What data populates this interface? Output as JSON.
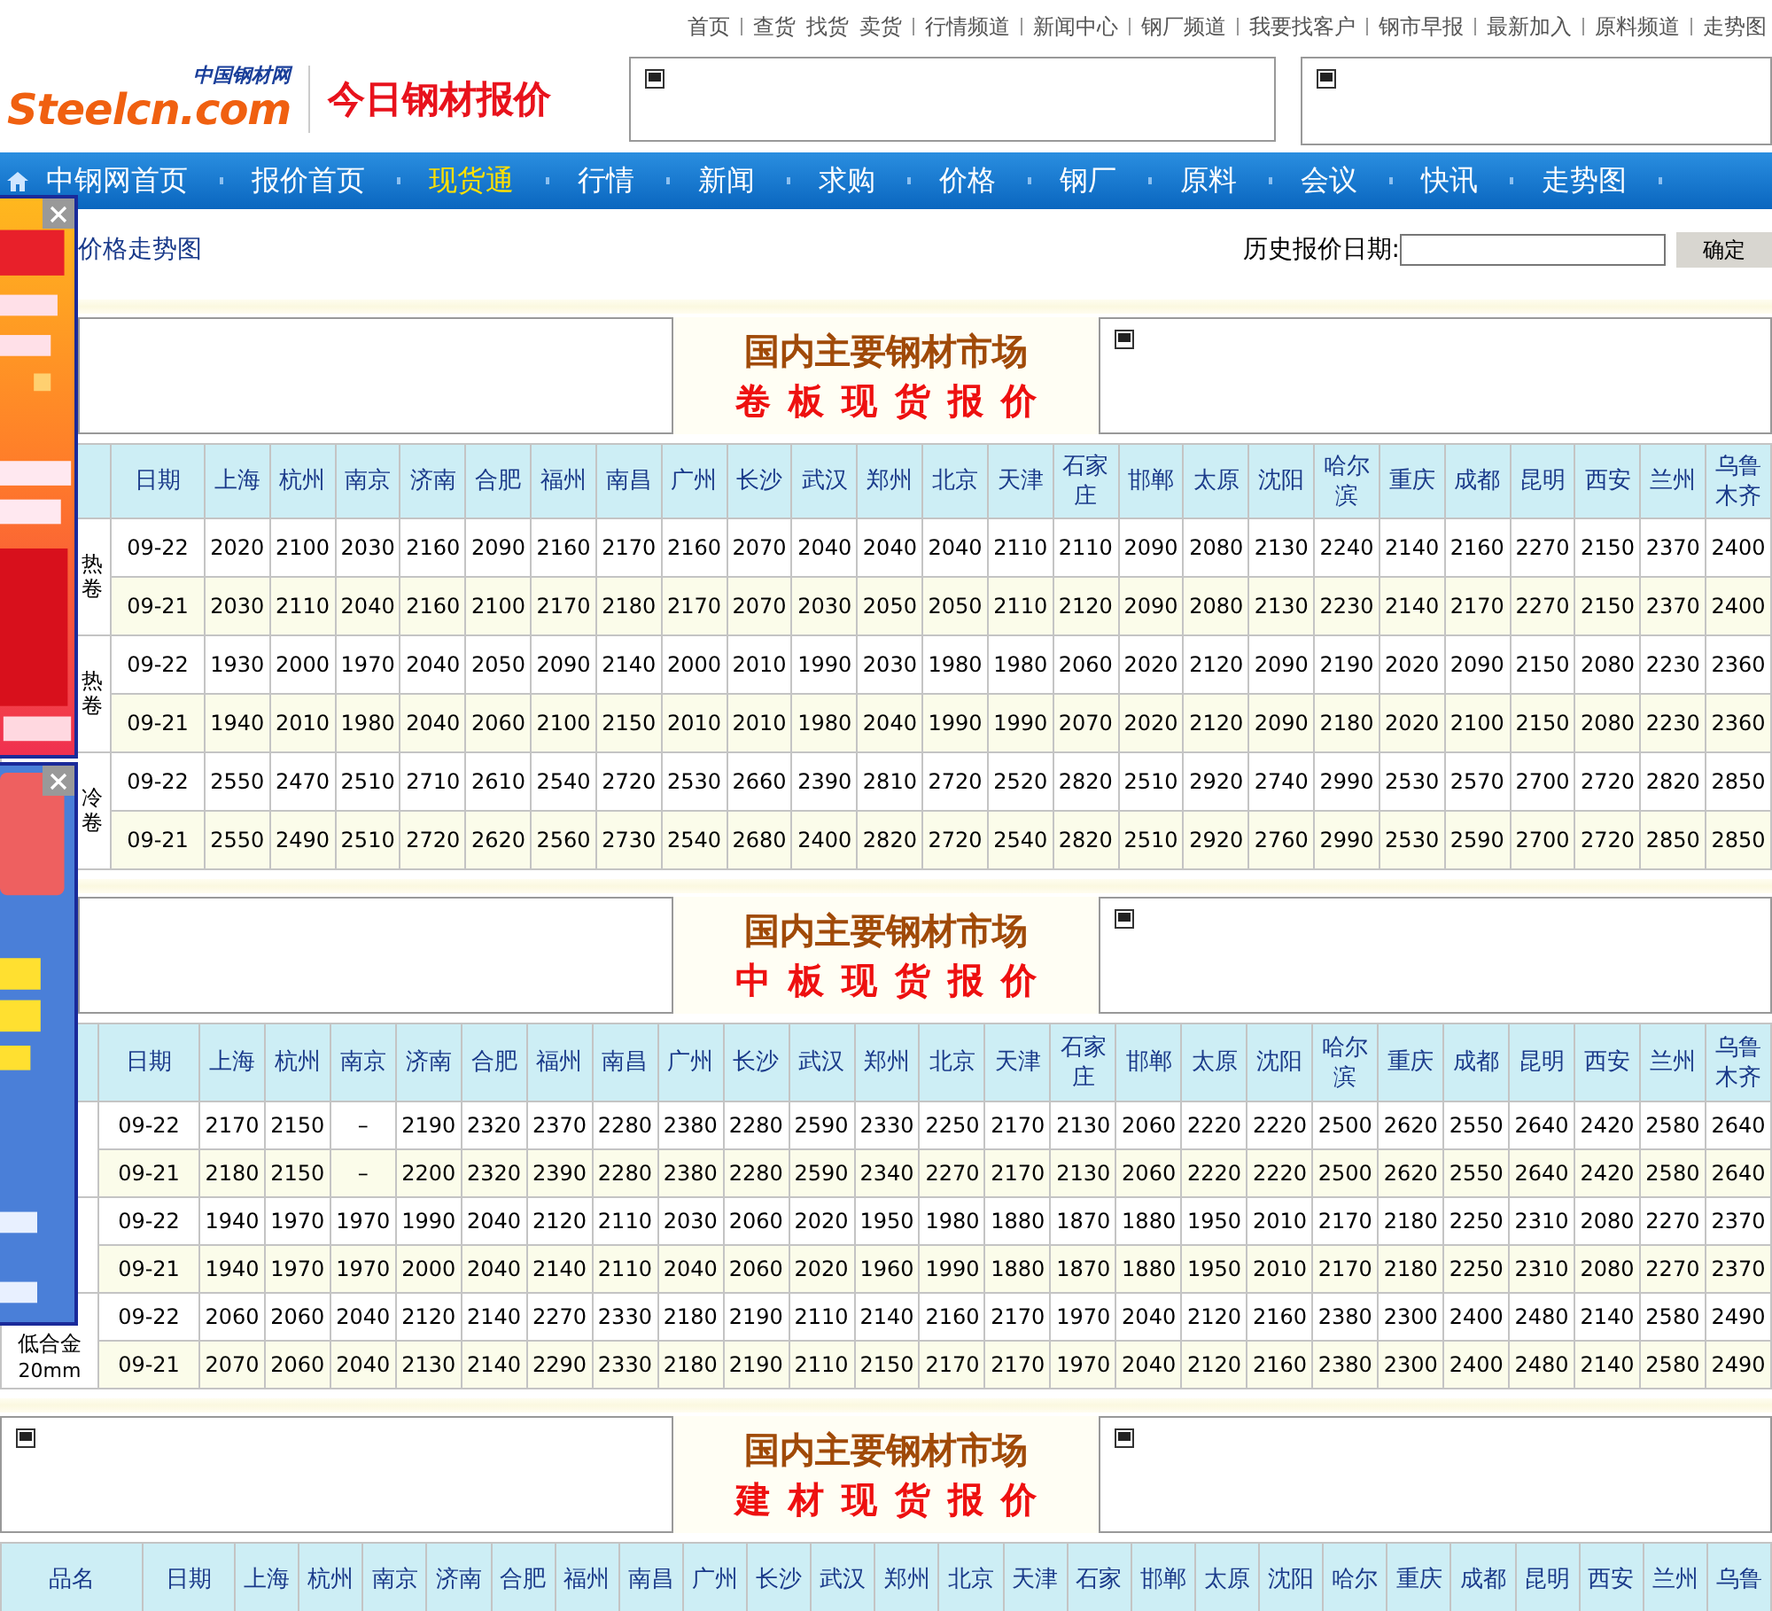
{
  "top_links": [
    [
      "首页"
    ],
    [
      "查货",
      "找货",
      "卖货"
    ],
    [
      "行情频道"
    ],
    [
      "新闻中心"
    ],
    [
      "钢厂频道"
    ],
    [
      "我要找客户"
    ],
    [
      "钢市早报"
    ],
    [
      "最新加入"
    ],
    [
      "原料频道"
    ],
    [
      "走势图"
    ]
  ],
  "logo": {
    "small": "中国钢材网",
    "main": "Steelcn.com",
    "title": "今日钢材报价"
  },
  "nav": [
    {
      "label": "中钢网首页",
      "selected": false
    },
    {
      "label": "报价首页",
      "selected": false
    },
    {
      "label": "现货通",
      "selected": true
    },
    {
      "label": "行情",
      "selected": false
    },
    {
      "label": "新闻",
      "selected": false
    },
    {
      "label": "求购",
      "selected": false
    },
    {
      "label": "价格",
      "selected": false
    },
    {
      "label": "钢厂",
      "selected": false
    },
    {
      "label": "原料",
      "selected": false
    },
    {
      "label": "会议",
      "selected": false
    },
    {
      "label": "快讯",
      "selected": false
    },
    {
      "label": "走势图",
      "selected": false
    }
  ],
  "breadcrumb_link": "价格走势图",
  "history": {
    "label": "历史报价日期:",
    "button": "确定"
  },
  "sections": [
    {
      "title": "国内主要钢材市场",
      "subtitle": "卷板现货报价",
      "table": {
        "columns": [
          "日期",
          "上海",
          "杭州",
          "南京",
          "济南",
          "合肥",
          "福州",
          "南昌",
          "广州",
          "长沙",
          "武汉",
          "郑州",
          "北京",
          "天津",
          "石家庄",
          "邯郸",
          "太原",
          "沈阳",
          "哈尔滨",
          "重庆",
          "成都",
          "昆明",
          "西安",
          "兰州",
          "乌鲁木齐"
        ],
        "groups": [
          {
            "product": "热卷",
            "rows": [
              {
                "date": "09-22",
                "prices": [
                  "2020",
                  "2100",
                  "2030",
                  "2160",
                  "2090",
                  "2160",
                  "2170",
                  "2160",
                  "2070",
                  "2040",
                  "2040",
                  "2040",
                  "2110",
                  "2110",
                  "2090",
                  "2080",
                  "2130",
                  "2240",
                  "2140",
                  "2160",
                  "2270",
                  "2150",
                  "2370",
                  "2400"
                ]
              },
              {
                "date": "09-21",
                "prices": [
                  "2030",
                  "2110",
                  "2040",
                  "2160",
                  "2100",
                  "2170",
                  "2180",
                  "2170",
                  "2070",
                  "2030",
                  "2050",
                  "2050",
                  "2110",
                  "2120",
                  "2090",
                  "2080",
                  "2130",
                  "2230",
                  "2140",
                  "2170",
                  "2270",
                  "2150",
                  "2370",
                  "2400"
                ]
              }
            ]
          },
          {
            "product": "热卷",
            "rows": [
              {
                "date": "09-22",
                "prices": [
                  "1930",
                  "2000",
                  "1970",
                  "2040",
                  "2050",
                  "2090",
                  "2140",
                  "2000",
                  "2010",
                  "1990",
                  "2030",
                  "1980",
                  "1980",
                  "2060",
                  "2020",
                  "2120",
                  "2090",
                  "2190",
                  "2020",
                  "2090",
                  "2150",
                  "2080",
                  "2230",
                  "2360"
                ]
              },
              {
                "date": "09-21",
                "prices": [
                  "1940",
                  "2010",
                  "1980",
                  "2040",
                  "2060",
                  "2100",
                  "2150",
                  "2010",
                  "2010",
                  "1980",
                  "2040",
                  "1990",
                  "1990",
                  "2070",
                  "2020",
                  "2120",
                  "2090",
                  "2180",
                  "2020",
                  "2100",
                  "2150",
                  "2080",
                  "2230",
                  "2360"
                ]
              }
            ]
          },
          {
            "product": "冷卷",
            "rows": [
              {
                "date": "09-22",
                "prices": [
                  "2550",
                  "2470",
                  "2510",
                  "2710",
                  "2610",
                  "2540",
                  "2720",
                  "2530",
                  "2660",
                  "2390",
                  "2810",
                  "2720",
                  "2520",
                  "2820",
                  "2510",
                  "2920",
                  "2740",
                  "2990",
                  "2530",
                  "2570",
                  "2700",
                  "2720",
                  "2820",
                  "2850"
                ]
              },
              {
                "date": "09-21",
                "prices": [
                  "2550",
                  "2490",
                  "2510",
                  "2720",
                  "2620",
                  "2560",
                  "2730",
                  "2540",
                  "2680",
                  "2400",
                  "2820",
                  "2720",
                  "2540",
                  "2820",
                  "2510",
                  "2920",
                  "2760",
                  "2990",
                  "2530",
                  "2590",
                  "2700",
                  "2720",
                  "2850",
                  "2850"
                ]
              }
            ]
          }
        ]
      }
    },
    {
      "title": "国内主要钢材市场",
      "subtitle": "中板现货报价",
      "table": {
        "columns": [
          "日期",
          "上海",
          "杭州",
          "南京",
          "济南",
          "合肥",
          "福州",
          "南昌",
          "广州",
          "长沙",
          "武汉",
          "郑州",
          "北京",
          "天津",
          "石家庄",
          "邯郸",
          "太原",
          "沈阳",
          "哈尔滨",
          "重庆",
          "成都",
          "昆明",
          "西安",
          "兰州",
          "乌鲁木齐"
        ],
        "groups": [
          {
            "rows": [
              {
                "date": "09-22",
                "prices": [
                  "2170",
                  "2150",
                  "–",
                  "2190",
                  "2320",
                  "2370",
                  "2280",
                  "2380",
                  "2280",
                  "2590",
                  "2330",
                  "2250",
                  "2170",
                  "2130",
                  "2060",
                  "2220",
                  "2220",
                  "2500",
                  "2620",
                  "2550",
                  "2640",
                  "2420",
                  "2580",
                  "2640"
                ]
              },
              {
                "date": "09-21",
                "prices": [
                  "2180",
                  "2150",
                  "–",
                  "2200",
                  "2320",
                  "2390",
                  "2280",
                  "2380",
                  "2280",
                  "2590",
                  "2340",
                  "2270",
                  "2170",
                  "2130",
                  "2060",
                  "2220",
                  "2220",
                  "2500",
                  "2620",
                  "2550",
                  "2640",
                  "2420",
                  "2580",
                  "2640"
                ]
              }
            ]
          },
          {
            "rows": [
              {
                "date": "09-22",
                "prices": [
                  "1940",
                  "1970",
                  "1970",
                  "1990",
                  "2040",
                  "2120",
                  "2110",
                  "2030",
                  "2060",
                  "2020",
                  "1950",
                  "1980",
                  "1880",
                  "1870",
                  "1880",
                  "1950",
                  "2010",
                  "2170",
                  "2180",
                  "2250",
                  "2310",
                  "2080",
                  "2270",
                  "2370"
                ]
              },
              {
                "date": "09-21",
                "prices": [
                  "1940",
                  "1970",
                  "1970",
                  "2000",
                  "2040",
                  "2140",
                  "2110",
                  "2040",
                  "2060",
                  "2020",
                  "1960",
                  "1990",
                  "1880",
                  "1870",
                  "1880",
                  "1950",
                  "2010",
                  "2170",
                  "2180",
                  "2250",
                  "2310",
                  "2080",
                  "2270",
                  "2370"
                ]
              }
            ]
          },
          {
            "product": "低合金",
            "spec": "20mm",
            "rows": [
              {
                "date": "09-22",
                "prices": [
                  "2060",
                  "2060",
                  "2040",
                  "2120",
                  "2140",
                  "2270",
                  "2330",
                  "2180",
                  "2190",
                  "2110",
                  "2140",
                  "2160",
                  "2170",
                  "1970",
                  "2040",
                  "2120",
                  "2160",
                  "2380",
                  "2300",
                  "2400",
                  "2480",
                  "2140",
                  "2580",
                  "2490"
                ]
              },
              {
                "date": "09-21",
                "prices": [
                  "2070",
                  "2060",
                  "2040",
                  "2130",
                  "2140",
                  "2290",
                  "2330",
                  "2180",
                  "2190",
                  "2110",
                  "2150",
                  "2170",
                  "2170",
                  "1970",
                  "2040",
                  "2120",
                  "2160",
                  "2380",
                  "2300",
                  "2400",
                  "2480",
                  "2140",
                  "2580",
                  "2490"
                ]
              }
            ]
          }
        ]
      }
    },
    {
      "title": "国内主要钢材市场",
      "subtitle": "建材现货报价",
      "table": {
        "columns": [
          "品名",
          "日期",
          "上海",
          "杭州",
          "南京",
          "济南",
          "合肥",
          "福州",
          "南昌",
          "广州",
          "长沙",
          "武汉",
          "郑州",
          "北京",
          "天津",
          "石家",
          "邯郸",
          "太原",
          "沈阳",
          "哈尔",
          "重庆",
          "成都",
          "昆明",
          "西安",
          "兰州",
          "乌鲁"
        ]
      }
    }
  ]
}
